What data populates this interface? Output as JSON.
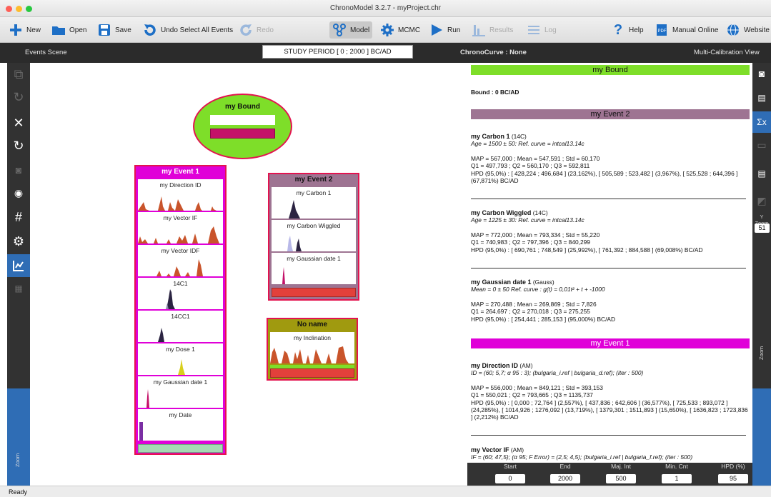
{
  "window": {
    "title": "ChronoModel 3.2.7 - myProject.chr"
  },
  "toolbar": {
    "new": "New",
    "open": "Open",
    "save": "Save",
    "undo": "Undo Select All Events",
    "redo": "Redo",
    "model": "Model",
    "mcmc": "MCMC",
    "run": "Run",
    "results": "Results",
    "log": "Log",
    "help": "Help",
    "manual": "Manual Online",
    "website": "Website"
  },
  "header": {
    "events_scene": "Events Scene",
    "study_period": "STUDY PERIOD [ 0 ; 2000 ] BC/AD",
    "chronocurve": "ChronoCurve : None",
    "multical": "Multi-Calibration View"
  },
  "left_sidebar": {
    "zoom_label": "Zoom"
  },
  "right_sidebar": {
    "yzoom_label": "Y Zoom",
    "yzoom_value": "51",
    "zoom_label": "Zoom"
  },
  "scene": {
    "bound": {
      "title": "my Bound",
      "color": "#7ede29"
    },
    "event1": {
      "title": "my Event 1",
      "color": "#e000d8",
      "dates": [
        "my Direction ID",
        "my Vector IF",
        "my Vector IDF",
        "14C1",
        "14CC1",
        "my Dose 1",
        "my Gaussian date 1",
        "my Date"
      ]
    },
    "event2": {
      "title": "my Event 2",
      "color": "#9e7492",
      "dates": [
        "my Carbon 1",
        "my Carbon Wiggled",
        "my Gaussian date 1"
      ]
    },
    "event3": {
      "title": "No name",
      "color": "#a09a0f",
      "dates": [
        "my Inclination"
      ]
    }
  },
  "panel": {
    "bound_header": "my Bound",
    "bound_text": "Bound : 0 BC/AD",
    "event2_header": "my Event 2",
    "event1_header": "my Event 1",
    "carbon1": {
      "name": "my Carbon 1",
      "type": "(14C)",
      "sub": "Age = 1500 ± 50: Ref. curve = intcal13.14c",
      "l1": "MAP = 567,000 ; Mean = 547,591 ; Std = 60,170",
      "l2": "Q1 = 497,793 ; Q2 = 560,170 ; Q3 = 592,811",
      "l3": "HPD (95,0%) : [ 428,224 ; 496,684 ] (23,162%), [ 505,589 ; 523,482 ] (3,967%), [ 525,528 ; 644,396 ] (67,871%) BC/AD"
    },
    "wiggled": {
      "name": "my Carbon Wiggled",
      "type": "(14C)",
      "sub": "Age = 1225 ± 30: Ref. curve = intcal13.14c",
      "l1": "MAP = 772,000 ; Mean = 793,334 ; Std = 55,220",
      "l2": "Q1 = 740,983 ; Q2 = 797,396 ; Q3 = 840,299",
      "l3": "HPD (95,0%) : [ 690,761 ; 748,549 ] (25,992%), [ 761,392 ; 884,588 ] (69,008%) BC/AD"
    },
    "gauss": {
      "name": "my Gaussian date 1",
      "type": "(Gauss)",
      "sub": "Mean = 0 ± 50 Ref. curve : g(t) = 0,01t² + t + -1000",
      "l1": "MAP = 270,488 ; Mean = 269,869 ; Std = 7,826",
      "l2": "Q1 = 264,697 ; Q2 = 270,018 ; Q3 = 275,255",
      "l3": "HPD (95,0%) : [ 254,441 ; 285,153 ] (95,000%) BC/AD"
    },
    "direction": {
      "name": "my Direction ID",
      "type": "(AM)",
      "sub": "ID = (60; 5,7; α 95 : 3); (bulgaria_i.ref | bulgaria_d.ref); (iter : 500)",
      "l1": "MAP = 556,000 ; Mean = 849,121 ; Std = 393,153",
      "l2": "Q1 = 550,021 ; Q2 = 793,665 ; Q3 = 1135,737",
      "l3": "HPD (95,0%) : [ 0,000 ; 72,764 ] (2,557%), [ 437,836 ; 642,606 ] (36,577%), [ 725,533 ; 893,072 ] (24,285%), [ 1014,926 ; 1276,092 ] (13,719%), [ 1379,301 ; 1511,893 ] (15,650%), [ 1636,823 ; 1723,836 ] (2,212%) BC/AD"
    },
    "vectorif": {
      "name": "my Vector IF",
      "type": "(AM)",
      "sub": "IF = (60; 47,5); (α 95; F Error) = (2,5; 4,5); (bulgaria_i.ref | bulgaria_f.ref); (iter : 500)"
    },
    "colors": {
      "bound": "#7ede29",
      "event2": "#9e7492",
      "event1": "#e000d8"
    }
  },
  "bottom": {
    "start_label": "Start",
    "start": "0",
    "end_label": "End",
    "end": "2000",
    "majint_label": "Maj. Int",
    "majint": "500",
    "mincnt_label": "Min. Cnt",
    "mincnt": "1",
    "hpd_label": "HPD (%)",
    "hpd": "95"
  },
  "status": "Ready"
}
